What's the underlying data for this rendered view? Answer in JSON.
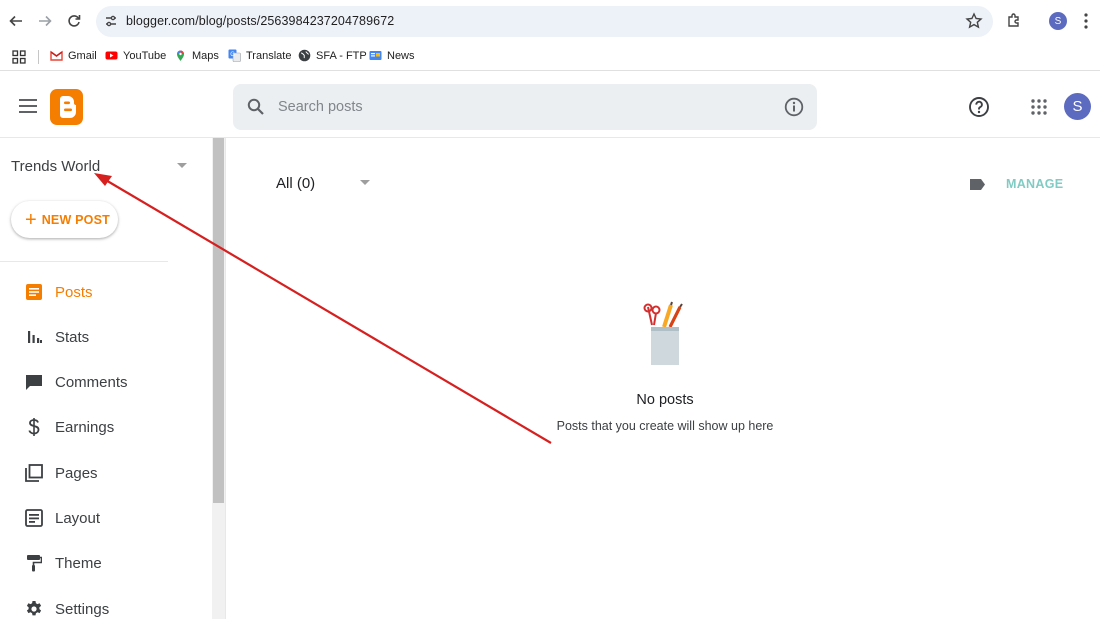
{
  "browser": {
    "url": "blogger.com/blog/posts/2563984237204789672",
    "profile_initial": "S",
    "bookmarks": [
      {
        "label": "Gmail",
        "icon": "gmail-icon"
      },
      {
        "label": "YouTube",
        "icon": "youtube-icon"
      },
      {
        "label": "Maps",
        "icon": "maps-icon"
      },
      {
        "label": "Translate",
        "icon": "translate-icon"
      },
      {
        "label": "SFA - FTP",
        "icon": "globe-icon"
      },
      {
        "label": "News",
        "icon": "news-icon"
      }
    ]
  },
  "header": {
    "search_placeholder": "Search posts",
    "avatar_initial": "S"
  },
  "sidebar": {
    "blog_name": "Trends World",
    "new_post_label": "NEW POST",
    "items": [
      {
        "label": "Posts",
        "icon": "posts-icon",
        "active": true
      },
      {
        "label": "Stats",
        "icon": "stats-icon"
      },
      {
        "label": "Comments",
        "icon": "comments-icon"
      },
      {
        "label": "Earnings",
        "icon": "dollar-icon"
      },
      {
        "label": "Pages",
        "icon": "pages-icon"
      },
      {
        "label": "Layout",
        "icon": "layout-icon"
      },
      {
        "label": "Theme",
        "icon": "paint-roller-icon"
      },
      {
        "label": "Settings",
        "icon": "gear-icon"
      }
    ]
  },
  "main": {
    "filter_label": "All (0)",
    "manage_label": "MANAGE",
    "empty_title": "No posts",
    "empty_subtitle": "Posts that you create will show up here"
  },
  "colors": {
    "accent": "#f57d00",
    "manage": "#80cbc4",
    "annotation_arrow": "#d62020"
  }
}
